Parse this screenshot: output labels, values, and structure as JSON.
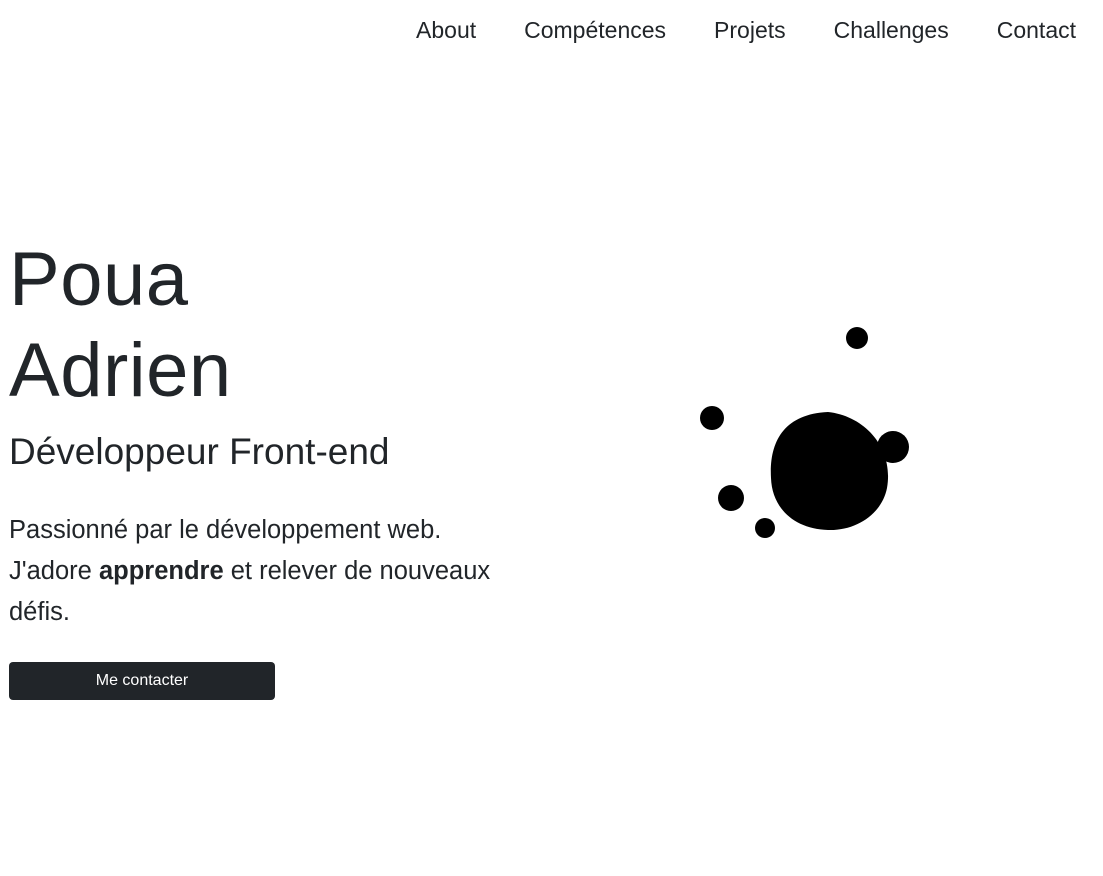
{
  "nav": {
    "items": [
      {
        "label": "About"
      },
      {
        "label": "Compétences"
      },
      {
        "label": "Projets"
      },
      {
        "label": "Challenges"
      },
      {
        "label": "Contact"
      }
    ]
  },
  "hero": {
    "first_name": "Poua",
    "last_name": "Adrien",
    "role": "Développeur Front-end",
    "desc_line1": "Passionné par le développement web.",
    "desc_line2_pre": "J'adore ",
    "desc_line2_bold": "apprendre",
    "desc_line2_post": " et relever de nouveaux défis.",
    "cta_label": "Me contacter"
  },
  "colors": {
    "text": "#212529",
    "button_bg": "#212529",
    "button_text": "#ffffff",
    "blob": "#000000"
  },
  "icons": {
    "illustration": "blob-illustration"
  }
}
